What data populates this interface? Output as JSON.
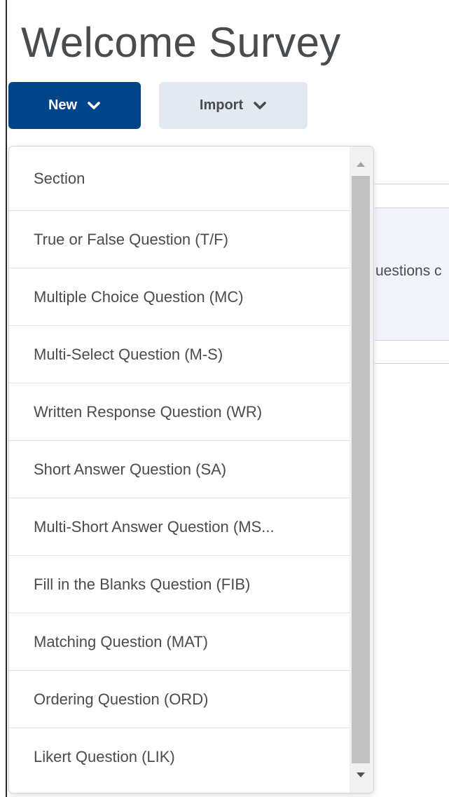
{
  "header": {
    "title": "Welcome Survey"
  },
  "toolbar": {
    "new_label": "New",
    "import_label": "Import"
  },
  "background": {
    "partial_text": "uestions c"
  },
  "menu": {
    "items": [
      {
        "label": "Section"
      },
      {
        "label": "True or False Question (T/F)"
      },
      {
        "label": "Multiple Choice Question (MC)"
      },
      {
        "label": "Multi-Select Question (M-S)"
      },
      {
        "label": "Written Response Question (WR)"
      },
      {
        "label": "Short Answer Question (SA)"
      },
      {
        "label": "Multi-Short Answer Question (MS..."
      },
      {
        "label": "Fill in the Blanks Question (FIB)"
      },
      {
        "label": "Matching Question (MAT)"
      },
      {
        "label": "Ordering Question (ORD)"
      },
      {
        "label": "Likert Question (LIK)"
      }
    ]
  },
  "colors": {
    "primary": "#004489",
    "secondary_button": "#e3e9f1",
    "text": "#494c4e"
  },
  "icons": {
    "new_dropdown": "chevron-down-icon",
    "import_dropdown": "chevron-down-icon",
    "scroll_up": "arrow-up-icon",
    "scroll_down": "arrow-down-icon"
  }
}
